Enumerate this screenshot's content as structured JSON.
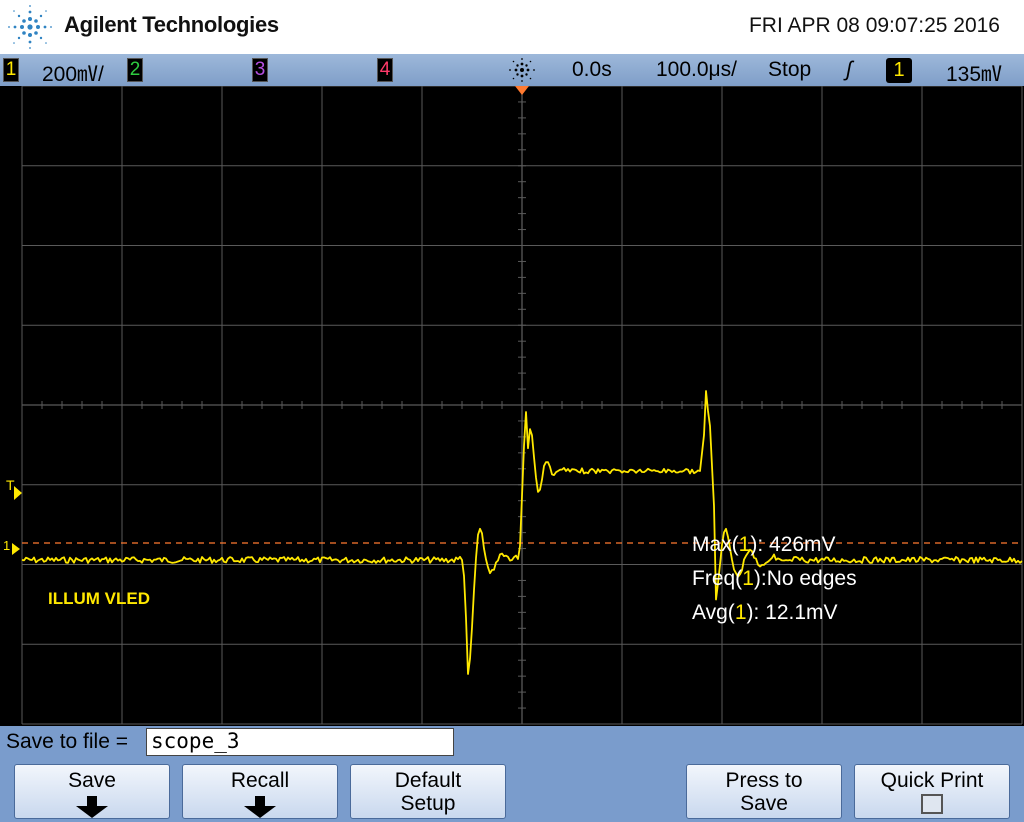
{
  "header": {
    "brand": "Agilent Technologies",
    "datetime": "FRI APR 08 09:07:25 2016"
  },
  "status": {
    "ch1": {
      "num": "1",
      "scale": "200㎷/",
      "color": "#ffe800"
    },
    "ch2": {
      "num": "2",
      "color": "#2ecc40"
    },
    "ch3": {
      "num": "3",
      "color": "#b44fe0"
    },
    "ch4": {
      "num": "4",
      "color": "#ff3a6a"
    },
    "delay": "0.0s",
    "timebase": "100.0μs/",
    "run_state": "Stop",
    "trigger_slope": "ʃ",
    "trigger_source": "1",
    "trigger_level": "135㎷"
  },
  "screen": {
    "label": "ILLUM VLED",
    "ch1_marker": "1",
    "trigger_marker": "T",
    "measurements": [
      {
        "prefix": "Max(",
        "ch": "1",
        "suffix": "): 426mV"
      },
      {
        "prefix": "Freq(",
        "ch": "1",
        "suffix": "):No edges"
      },
      {
        "prefix": "Avg(",
        "ch": "1",
        "suffix": "): 12.1mV"
      }
    ]
  },
  "file": {
    "label": "Save to file =",
    "value": "scope_3"
  },
  "softkeys": [
    {
      "line1": "Save",
      "line2": ""
    },
    {
      "line1": "Recall",
      "line2": ""
    },
    {
      "line1": "Default",
      "line2": "Setup"
    },
    {
      "line1": "Press to",
      "line2": "Save"
    },
    {
      "line1": "Quick Print",
      "line2": ""
    }
  ],
  "colors": {
    "trace": "#ffe800",
    "grid": "#5a5a5a",
    "trigger_ref": "#ff7a30"
  }
}
